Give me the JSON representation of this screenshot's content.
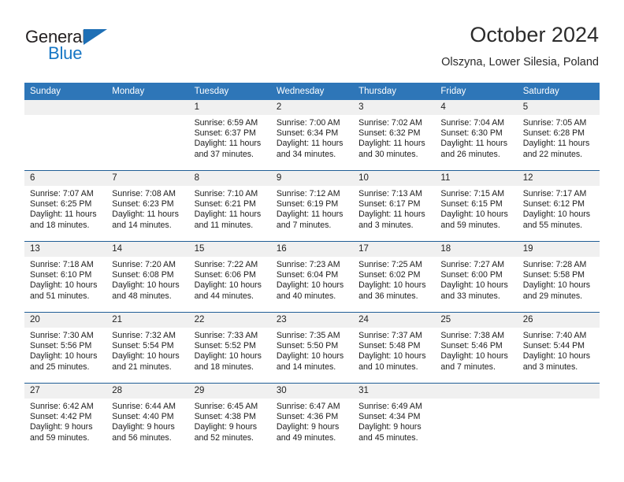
{
  "brand": {
    "word1": "General",
    "word2": "Blue",
    "triangle_color": "#1e6fb5"
  },
  "header": {
    "title": "October 2024",
    "location": "Olszyna, Lower Silesia, Poland"
  },
  "theme": {
    "header_blue": "#2e76b8",
    "rule_blue": "#215e96",
    "daynum_band": "#f0f0f0"
  },
  "calendar": {
    "weekday_headers": [
      "Sunday",
      "Monday",
      "Tuesday",
      "Wednesday",
      "Thursday",
      "Friday",
      "Saturday"
    ],
    "weeks": [
      [
        {
          "day": "",
          "sunrise": "",
          "sunset": "",
          "daylight_line1": "",
          "daylight_line2": ""
        },
        {
          "day": "",
          "sunrise": "",
          "sunset": "",
          "daylight_line1": "",
          "daylight_line2": ""
        },
        {
          "day": "1",
          "sunrise": "Sunrise: 6:59 AM",
          "sunset": "Sunset: 6:37 PM",
          "daylight_line1": "Daylight: 11 hours",
          "daylight_line2": "and 37 minutes."
        },
        {
          "day": "2",
          "sunrise": "Sunrise: 7:00 AM",
          "sunset": "Sunset: 6:34 PM",
          "daylight_line1": "Daylight: 11 hours",
          "daylight_line2": "and 34 minutes."
        },
        {
          "day": "3",
          "sunrise": "Sunrise: 7:02 AM",
          "sunset": "Sunset: 6:32 PM",
          "daylight_line1": "Daylight: 11 hours",
          "daylight_line2": "and 30 minutes."
        },
        {
          "day": "4",
          "sunrise": "Sunrise: 7:04 AM",
          "sunset": "Sunset: 6:30 PM",
          "daylight_line1": "Daylight: 11 hours",
          "daylight_line2": "and 26 minutes."
        },
        {
          "day": "5",
          "sunrise": "Sunrise: 7:05 AM",
          "sunset": "Sunset: 6:28 PM",
          "daylight_line1": "Daylight: 11 hours",
          "daylight_line2": "and 22 minutes."
        }
      ],
      [
        {
          "day": "6",
          "sunrise": "Sunrise: 7:07 AM",
          "sunset": "Sunset: 6:25 PM",
          "daylight_line1": "Daylight: 11 hours",
          "daylight_line2": "and 18 minutes."
        },
        {
          "day": "7",
          "sunrise": "Sunrise: 7:08 AM",
          "sunset": "Sunset: 6:23 PM",
          "daylight_line1": "Daylight: 11 hours",
          "daylight_line2": "and 14 minutes."
        },
        {
          "day": "8",
          "sunrise": "Sunrise: 7:10 AM",
          "sunset": "Sunset: 6:21 PM",
          "daylight_line1": "Daylight: 11 hours",
          "daylight_line2": "and 11 minutes."
        },
        {
          "day": "9",
          "sunrise": "Sunrise: 7:12 AM",
          "sunset": "Sunset: 6:19 PM",
          "daylight_line1": "Daylight: 11 hours",
          "daylight_line2": "and 7 minutes."
        },
        {
          "day": "10",
          "sunrise": "Sunrise: 7:13 AM",
          "sunset": "Sunset: 6:17 PM",
          "daylight_line1": "Daylight: 11 hours",
          "daylight_line2": "and 3 minutes."
        },
        {
          "day": "11",
          "sunrise": "Sunrise: 7:15 AM",
          "sunset": "Sunset: 6:15 PM",
          "daylight_line1": "Daylight: 10 hours",
          "daylight_line2": "and 59 minutes."
        },
        {
          "day": "12",
          "sunrise": "Sunrise: 7:17 AM",
          "sunset": "Sunset: 6:12 PM",
          "daylight_line1": "Daylight: 10 hours",
          "daylight_line2": "and 55 minutes."
        }
      ],
      [
        {
          "day": "13",
          "sunrise": "Sunrise: 7:18 AM",
          "sunset": "Sunset: 6:10 PM",
          "daylight_line1": "Daylight: 10 hours",
          "daylight_line2": "and 51 minutes."
        },
        {
          "day": "14",
          "sunrise": "Sunrise: 7:20 AM",
          "sunset": "Sunset: 6:08 PM",
          "daylight_line1": "Daylight: 10 hours",
          "daylight_line2": "and 48 minutes."
        },
        {
          "day": "15",
          "sunrise": "Sunrise: 7:22 AM",
          "sunset": "Sunset: 6:06 PM",
          "daylight_line1": "Daylight: 10 hours",
          "daylight_line2": "and 44 minutes."
        },
        {
          "day": "16",
          "sunrise": "Sunrise: 7:23 AM",
          "sunset": "Sunset: 6:04 PM",
          "daylight_line1": "Daylight: 10 hours",
          "daylight_line2": "and 40 minutes."
        },
        {
          "day": "17",
          "sunrise": "Sunrise: 7:25 AM",
          "sunset": "Sunset: 6:02 PM",
          "daylight_line1": "Daylight: 10 hours",
          "daylight_line2": "and 36 minutes."
        },
        {
          "day": "18",
          "sunrise": "Sunrise: 7:27 AM",
          "sunset": "Sunset: 6:00 PM",
          "daylight_line1": "Daylight: 10 hours",
          "daylight_line2": "and 33 minutes."
        },
        {
          "day": "19",
          "sunrise": "Sunrise: 7:28 AM",
          "sunset": "Sunset: 5:58 PM",
          "daylight_line1": "Daylight: 10 hours",
          "daylight_line2": "and 29 minutes."
        }
      ],
      [
        {
          "day": "20",
          "sunrise": "Sunrise: 7:30 AM",
          "sunset": "Sunset: 5:56 PM",
          "daylight_line1": "Daylight: 10 hours",
          "daylight_line2": "and 25 minutes."
        },
        {
          "day": "21",
          "sunrise": "Sunrise: 7:32 AM",
          "sunset": "Sunset: 5:54 PM",
          "daylight_line1": "Daylight: 10 hours",
          "daylight_line2": "and 21 minutes."
        },
        {
          "day": "22",
          "sunrise": "Sunrise: 7:33 AM",
          "sunset": "Sunset: 5:52 PM",
          "daylight_line1": "Daylight: 10 hours",
          "daylight_line2": "and 18 minutes."
        },
        {
          "day": "23",
          "sunrise": "Sunrise: 7:35 AM",
          "sunset": "Sunset: 5:50 PM",
          "daylight_line1": "Daylight: 10 hours",
          "daylight_line2": "and 14 minutes."
        },
        {
          "day": "24",
          "sunrise": "Sunrise: 7:37 AM",
          "sunset": "Sunset: 5:48 PM",
          "daylight_line1": "Daylight: 10 hours",
          "daylight_line2": "and 10 minutes."
        },
        {
          "day": "25",
          "sunrise": "Sunrise: 7:38 AM",
          "sunset": "Sunset: 5:46 PM",
          "daylight_line1": "Daylight: 10 hours",
          "daylight_line2": "and 7 minutes."
        },
        {
          "day": "26",
          "sunrise": "Sunrise: 7:40 AM",
          "sunset": "Sunset: 5:44 PM",
          "daylight_line1": "Daylight: 10 hours",
          "daylight_line2": "and 3 minutes."
        }
      ],
      [
        {
          "day": "27",
          "sunrise": "Sunrise: 6:42 AM",
          "sunset": "Sunset: 4:42 PM",
          "daylight_line1": "Daylight: 9 hours",
          "daylight_line2": "and 59 minutes."
        },
        {
          "day": "28",
          "sunrise": "Sunrise: 6:44 AM",
          "sunset": "Sunset: 4:40 PM",
          "daylight_line1": "Daylight: 9 hours",
          "daylight_line2": "and 56 minutes."
        },
        {
          "day": "29",
          "sunrise": "Sunrise: 6:45 AM",
          "sunset": "Sunset: 4:38 PM",
          "daylight_line1": "Daylight: 9 hours",
          "daylight_line2": "and 52 minutes."
        },
        {
          "day": "30",
          "sunrise": "Sunrise: 6:47 AM",
          "sunset": "Sunset: 4:36 PM",
          "daylight_line1": "Daylight: 9 hours",
          "daylight_line2": "and 49 minutes."
        },
        {
          "day": "31",
          "sunrise": "Sunrise: 6:49 AM",
          "sunset": "Sunset: 4:34 PM",
          "daylight_line1": "Daylight: 9 hours",
          "daylight_line2": "and 45 minutes."
        },
        {
          "day": "",
          "sunrise": "",
          "sunset": "",
          "daylight_line1": "",
          "daylight_line2": ""
        },
        {
          "day": "",
          "sunrise": "",
          "sunset": "",
          "daylight_line1": "",
          "daylight_line2": ""
        }
      ]
    ]
  }
}
